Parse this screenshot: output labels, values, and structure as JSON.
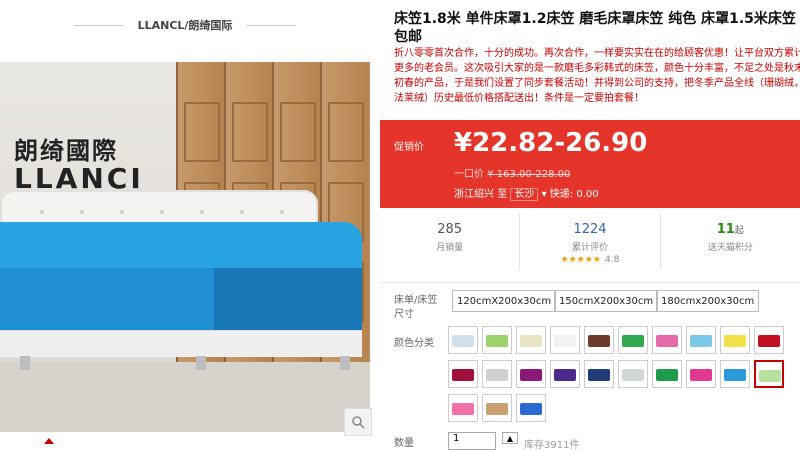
{
  "shop": {
    "title": "LLANCL/朗绮国际"
  },
  "brand_logo": {
    "cn": "朗绮國際",
    "en": "LLANCI"
  },
  "product": {
    "title": "床笠1.8米 单件床罩1.2床笠 磨毛床罩床笠 纯色 床罩1.5米床笠 包邮",
    "desc": "折八零零首次合作，十分的成功。再次合作，一样要实实在在的给顾客优惠！让平台双方累计更多的老会员。这次吸引大家的是一款磨毛多彩韩式的床笠，颜色十分丰富，不足之处是秋末初春的产品，于是我们设置了同步套餐活动！并得到公司的支持，把冬季产品全线（珊瑚绒，法莱绒）历史最低价格搭配送出！条件是一定要拍套餐！"
  },
  "price": {
    "label": "促销价",
    "value": "¥22.82-26.90",
    "yikou_label": "一口价",
    "yikou_value": "¥ 163.00-228.00",
    "from": "浙江绍兴",
    "to_label": "至",
    "to": "长沙",
    "ship": "快递: 0.00"
  },
  "stats": {
    "sales": {
      "value": "285",
      "label": "月销量"
    },
    "reviews": {
      "value": "1224",
      "label": "累计评价",
      "rating": "4.8"
    },
    "points": {
      "value": "11",
      "unit": "起",
      "label": "送天猫积分"
    }
  },
  "size": {
    "label": "床单/床笠尺寸",
    "options": [
      "120cmX200x30cm",
      "150cmX200x30cm",
      "180cmx200x30cm"
    ]
  },
  "color": {
    "label": "颜色分类",
    "swatches": [
      "#cfe0ea",
      "#9ed36b",
      "#e9e4c4",
      "#f2f2f2",
      "#6b3b2a",
      "#2fa84f",
      "#e56aa8",
      "#7cc8e8",
      "#f0e04a",
      "#c01020",
      "#a0103a",
      "#cfcfcf",
      "#8a1a7a",
      "#4a2a8a",
      "#1e3b7a",
      "#cfd8d6",
      "#1e9a4a",
      "#e03890",
      "#2a9ad8",
      "#b8e0a0",
      "#f070a8",
      "#c8a070",
      "#2a6ad0"
    ]
  },
  "quantity": {
    "label": "数量",
    "value": "1",
    "stock": "库存3911件"
  }
}
